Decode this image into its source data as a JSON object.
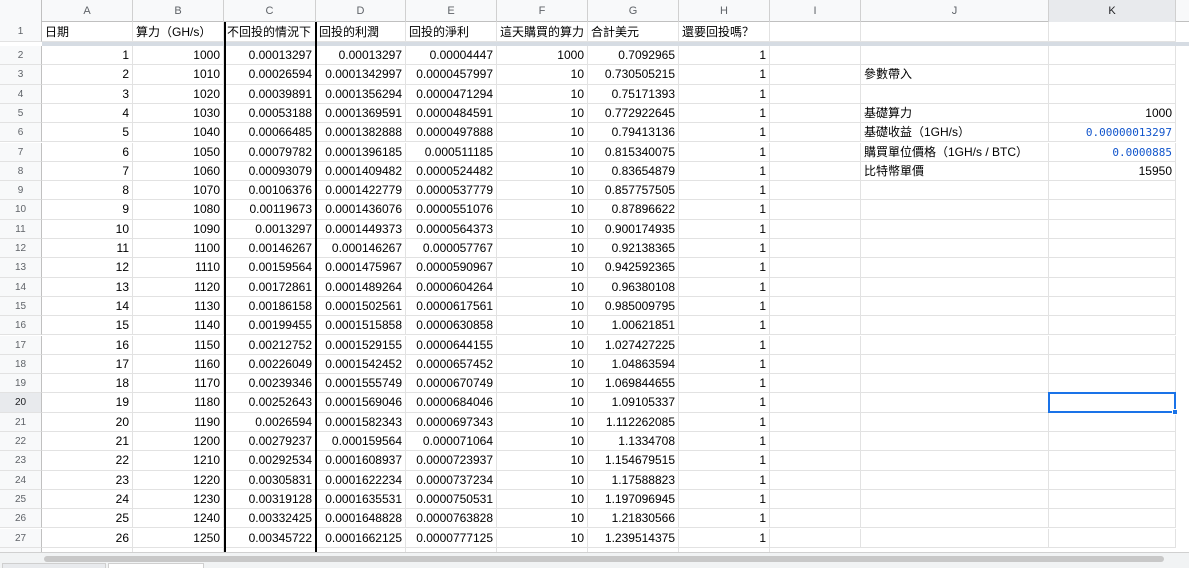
{
  "columns": [
    "A",
    "B",
    "C",
    "D",
    "E",
    "F",
    "G",
    "H",
    "I",
    "J",
    "K"
  ],
  "active_column": "K",
  "active_row": 20,
  "header_row_number": 1,
  "headers": [
    "日期",
    "算力（GH/s）",
    "不回投的情況下",
    "回投的利潤",
    "回投的淨利",
    "這天購買的算力",
    "合計美元",
    "還要回投嗎？"
  ],
  "rows": [
    {
      "n": 2,
      "a": "1",
      "b": "1000",
      "c": "0.00013297",
      "d": "0.00013297",
      "e": "0.00004447",
      "f": "1000",
      "g": "0.7092965",
      "h": "1"
    },
    {
      "n": 3,
      "a": "2",
      "b": "1010",
      "c": "0.00026594",
      "d": "0.0001342997",
      "e": "0.0000457997",
      "f": "10",
      "g": "0.730505215",
      "h": "1"
    },
    {
      "n": 4,
      "a": "3",
      "b": "1020",
      "c": "0.00039891",
      "d": "0.0001356294",
      "e": "0.0000471294",
      "f": "10",
      "g": "0.75171393",
      "h": "1"
    },
    {
      "n": 5,
      "a": "4",
      "b": "1030",
      "c": "0.00053188",
      "d": "0.0001369591",
      "e": "0.0000484591",
      "f": "10",
      "g": "0.772922645",
      "h": "1"
    },
    {
      "n": 6,
      "a": "5",
      "b": "1040",
      "c": "0.00066485",
      "d": "0.0001382888",
      "e": "0.0000497888",
      "f": "10",
      "g": "0.79413136",
      "h": "1"
    },
    {
      "n": 7,
      "a": "6",
      "b": "1050",
      "c": "0.00079782",
      "d": "0.0001396185",
      "e": "0.000511185",
      "f": "10",
      "g": "0.815340075",
      "h": "1"
    },
    {
      "n": 8,
      "a": "7",
      "b": "1060",
      "c": "0.00093079",
      "d": "0.0001409482",
      "e": "0.0000524482",
      "f": "10",
      "g": "0.83654879",
      "h": "1"
    },
    {
      "n": 9,
      "a": "8",
      "b": "1070",
      "c": "0.00106376",
      "d": "0.0001422779",
      "e": "0.0000537779",
      "f": "10",
      "g": "0.857757505",
      "h": "1"
    },
    {
      "n": 10,
      "a": "9",
      "b": "1080",
      "c": "0.00119673",
      "d": "0.0001436076",
      "e": "0.0000551076",
      "f": "10",
      "g": "0.87896622",
      "h": "1"
    },
    {
      "n": 11,
      "a": "10",
      "b": "1090",
      "c": "0.0013297",
      "d": "0.0001449373",
      "e": "0.0000564373",
      "f": "10",
      "g": "0.900174935",
      "h": "1"
    },
    {
      "n": 12,
      "a": "11",
      "b": "1100",
      "c": "0.00146267",
      "d": "0.000146267",
      "e": "0.000057767",
      "f": "10",
      "g": "0.92138365",
      "h": "1"
    },
    {
      "n": 13,
      "a": "12",
      "b": "1110",
      "c": "0.00159564",
      "d": "0.0001475967",
      "e": "0.0000590967",
      "f": "10",
      "g": "0.942592365",
      "h": "1"
    },
    {
      "n": 14,
      "a": "13",
      "b": "1120",
      "c": "0.00172861",
      "d": "0.0001489264",
      "e": "0.0000604264",
      "f": "10",
      "g": "0.96380108",
      "h": "1"
    },
    {
      "n": 15,
      "a": "14",
      "b": "1130",
      "c": "0.00186158",
      "d": "0.0001502561",
      "e": "0.0000617561",
      "f": "10",
      "g": "0.985009795",
      "h": "1"
    },
    {
      "n": 16,
      "a": "15",
      "b": "1140",
      "c": "0.00199455",
      "d": "0.0001515858",
      "e": "0.0000630858",
      "f": "10",
      "g": "1.00621851",
      "h": "1"
    },
    {
      "n": 17,
      "a": "16",
      "b": "1150",
      "c": "0.00212752",
      "d": "0.0001529155",
      "e": "0.0000644155",
      "f": "10",
      "g": "1.027427225",
      "h": "1"
    },
    {
      "n": 18,
      "a": "17",
      "b": "1160",
      "c": "0.00226049",
      "d": "0.0001542452",
      "e": "0.0000657452",
      "f": "10",
      "g": "1.04863594",
      "h": "1"
    },
    {
      "n": 19,
      "a": "18",
      "b": "1170",
      "c": "0.00239346",
      "d": "0.0001555749",
      "e": "0.0000670749",
      "f": "10",
      "g": "1.069844655",
      "h": "1"
    },
    {
      "n": 20,
      "a": "19",
      "b": "1180",
      "c": "0.00252643",
      "d": "0.0001569046",
      "e": "0.0000684046",
      "f": "10",
      "g": "1.09105337",
      "h": "1"
    },
    {
      "n": 21,
      "a": "20",
      "b": "1190",
      "c": "0.0026594",
      "d": "0.0001582343",
      "e": "0.0000697343",
      "f": "10",
      "g": "1.112262085",
      "h": "1"
    },
    {
      "n": 22,
      "a": "21",
      "b": "1200",
      "c": "0.00279237",
      "d": "0.000159564",
      "e": "0.000071064",
      "f": "10",
      "g": "1.1334708",
      "h": "1"
    },
    {
      "n": 23,
      "a": "22",
      "b": "1210",
      "c": "0.00292534",
      "d": "0.0001608937",
      "e": "0.0000723937",
      "f": "10",
      "g": "1.154679515",
      "h": "1"
    },
    {
      "n": 24,
      "a": "23",
      "b": "1220",
      "c": "0.00305831",
      "d": "0.0001622234",
      "e": "0.0000737234",
      "f": "10",
      "g": "1.17588823",
      "h": "1"
    },
    {
      "n": 25,
      "a": "24",
      "b": "1230",
      "c": "0.00319128",
      "d": "0.0001635531",
      "e": "0.0000750531",
      "f": "10",
      "g": "1.197096945",
      "h": "1"
    },
    {
      "n": 26,
      "a": "25",
      "b": "1240",
      "c": "0.00332425",
      "d": "0.0001648828",
      "e": "0.0000763828",
      "f": "10",
      "g": "1.21830566",
      "h": "1"
    },
    {
      "n": 27,
      "a": "26",
      "b": "1250",
      "c": "0.00345722",
      "d": "0.0001662125",
      "e": "0.0000777125",
      "f": "10",
      "g": "1.239514375",
      "h": "1"
    }
  ],
  "params": {
    "title": "參數帶入",
    "items": [
      {
        "row": 5,
        "label": "基礎算力",
        "value": "1000",
        "style": "plain"
      },
      {
        "row": 6,
        "label": "基礎收益（1GH/s）",
        "value": "0.00000013297",
        "style": "mono"
      },
      {
        "row": 7,
        "label": "購買單位價格（1GH/s / BTC）",
        "value": "0.0000885",
        "style": "mono"
      },
      {
        "row": 8,
        "label": "比特幣單價",
        "value": "15950",
        "style": "plain"
      }
    ]
  }
}
